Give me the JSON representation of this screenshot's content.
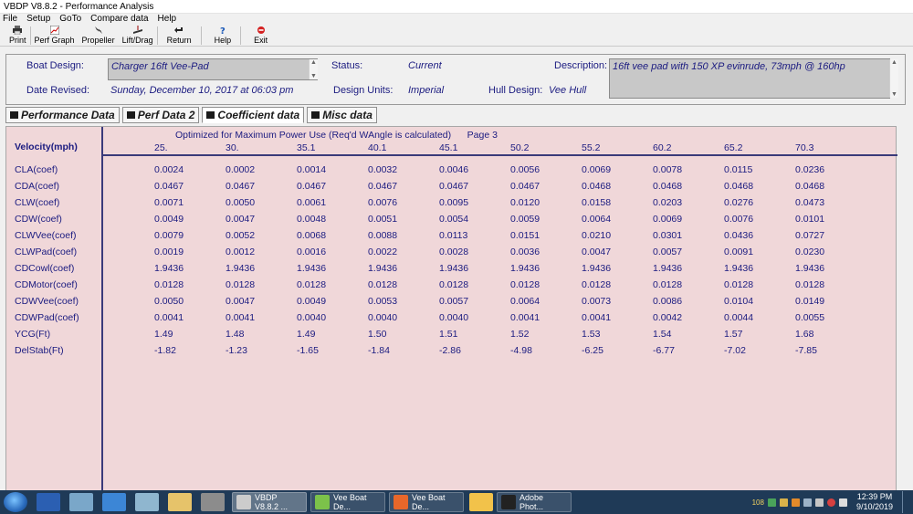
{
  "window": {
    "title": "VBDP V8.8.2 - Performance Analysis"
  },
  "menu": [
    "File",
    "Setup",
    "GoTo",
    "Compare data",
    "Help"
  ],
  "toolbar": {
    "print": "Print",
    "perf_graph": "Perf Graph",
    "propeller": "Propeller",
    "lift_drag": "Lift/Drag",
    "return": "Return",
    "help": "Help",
    "exit": "Exit"
  },
  "header": {
    "boat_design_label": "Boat Design:",
    "boat_design_value": "Charger 16ft Vee-Pad",
    "status_label": "Status:",
    "status_value": "Current",
    "description_label": "Description:",
    "description_value": "16ft vee pad with 150 XP evinrude, 73mph @ 160hp",
    "date_label": "Date Revised:",
    "date_value": "Sunday, December 10, 2017 at 06:03 pm",
    "units_label": "Design Units:",
    "units_value": "Imperial",
    "hull_label": "Hull Design:",
    "hull_value": "Vee Hull"
  },
  "tabs": [
    "Performance Data",
    "Perf Data 2",
    "Coefficient data",
    "Misc data"
  ],
  "active_tab": "Coefficient data",
  "grid": {
    "subtitle": "Optimized for Maximum Power Use (Req'd WAngle is calculated)",
    "page": "Page 3",
    "velocity_label": "Velocity(mph)",
    "velocities": [
      "25.",
      "30.",
      "35.1",
      "40.1",
      "45.1",
      "50.2",
      "55.2",
      "60.2",
      "65.2",
      "70.3"
    ],
    "rows": [
      {
        "label": "CLA(coef)",
        "values": [
          "0.0024",
          "0.0002",
          "0.0014",
          "0.0032",
          "0.0046",
          "0.0056",
          "0.0069",
          "0.0078",
          "0.0115",
          "0.0236"
        ]
      },
      {
        "label": "CDA(coef)",
        "values": [
          "0.0467",
          "0.0467",
          "0.0467",
          "0.0467",
          "0.0467",
          "0.0467",
          "0.0468",
          "0.0468",
          "0.0468",
          "0.0468"
        ]
      },
      {
        "label": "CLW(coef)",
        "values": [
          "0.0071",
          "0.0050",
          "0.0061",
          "0.0076",
          "0.0095",
          "0.0120",
          "0.0158",
          "0.0203",
          "0.0276",
          "0.0473"
        ]
      },
      {
        "label": "CDW(coef)",
        "values": [
          "0.0049",
          "0.0047",
          "0.0048",
          "0.0051",
          "0.0054",
          "0.0059",
          "0.0064",
          "0.0069",
          "0.0076",
          "0.0101"
        ]
      },
      {
        "label": "CLWVee(coef)",
        "values": [
          "0.0079",
          "0.0052",
          "0.0068",
          "0.0088",
          "0.0113",
          "0.0151",
          "0.0210",
          "0.0301",
          "0.0436",
          "0.0727"
        ]
      },
      {
        "label": "CLWPad(coef)",
        "values": [
          "0.0019",
          "0.0012",
          "0.0016",
          "0.0022",
          "0.0028",
          "0.0036",
          "0.0047",
          "0.0057",
          "0.0091",
          "0.0230"
        ]
      },
      {
        "label": "CDCowl(coef)",
        "values": [
          "1.9436",
          "1.9436",
          "1.9436",
          "1.9436",
          "1.9436",
          "1.9436",
          "1.9436",
          "1.9436",
          "1.9436",
          "1.9436"
        ]
      },
      {
        "label": "CDMotor(coef)",
        "values": [
          "0.0128",
          "0.0128",
          "0.0128",
          "0.0128",
          "0.0128",
          "0.0128",
          "0.0128",
          "0.0128",
          "0.0128",
          "0.0128"
        ]
      },
      {
        "label": "CDWVee(coef)",
        "values": [
          "0.0050",
          "0.0047",
          "0.0049",
          "0.0053",
          "0.0057",
          "0.0064",
          "0.0073",
          "0.0086",
          "0.0104",
          "0.0149"
        ]
      },
      {
        "label": "CDWPad(coef)",
        "values": [
          "0.0041",
          "0.0041",
          "0.0040",
          "0.0040",
          "0.0040",
          "0.0041",
          "0.0041",
          "0.0042",
          "0.0044",
          "0.0055"
        ]
      },
      {
        "label": "YCG(Ft)",
        "values": [
          "1.49",
          "1.48",
          "1.49",
          "1.50",
          "1.51",
          "1.52",
          "1.53",
          "1.54",
          "1.57",
          "1.68"
        ]
      },
      {
        "label": "DelStab(Ft)",
        "values": [
          "-1.82",
          "-1.23",
          "-1.65",
          "-1.84",
          "-2.86",
          "-4.98",
          "-6.25",
          "-6.77",
          "-7.02",
          "-7.85"
        ]
      }
    ]
  },
  "taskbar": {
    "tasks": [
      "VBDP V8.8.2 ...",
      "Vee Boat De...",
      "Vee Boat De...",
      "Adobe Phot..."
    ],
    "time": "12:39 PM",
    "date": "9/10/2019",
    "tray_number": "108"
  },
  "colors": {
    "grid_bg": "#f0d7d9",
    "text_blue": "#1b1b80",
    "taskbar": "#1f3a57"
  }
}
